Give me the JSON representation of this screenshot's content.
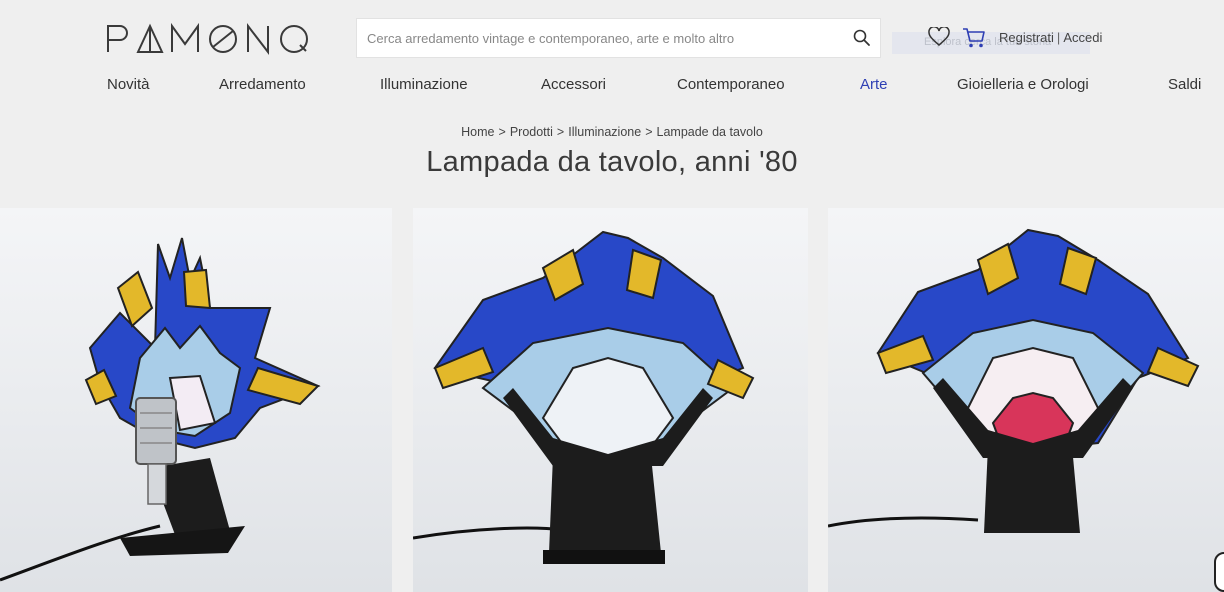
{
  "brand": {
    "logo_text": "PAMONO"
  },
  "search": {
    "placeholder": "Cerca arredamento vintage e contemporaneo, arte e molto altro",
    "overlay_text": "Esplora cerca la tua storia"
  },
  "account": {
    "register": "Registrati",
    "separator": "|",
    "login": "Accedi"
  },
  "nav": {
    "items": [
      {
        "label": "Novità"
      },
      {
        "label": "Arredamento"
      },
      {
        "label": "Illuminazione"
      },
      {
        "label": "Accessori"
      },
      {
        "label": "Contemporaneo"
      },
      {
        "label": "Arte"
      },
      {
        "label": "Gioielleria e Orologi"
      },
      {
        "label": "Saldi"
      }
    ],
    "active": "Arte"
  },
  "breadcrumb": {
    "items": [
      {
        "label": "Home"
      },
      {
        "label": "Prodotti"
      },
      {
        "label": "Illuminazione"
      },
      {
        "label": "Lampade da tavolo"
      }
    ],
    "separator": ">"
  },
  "product": {
    "title": "Lampada da tavolo, anni '80"
  },
  "icons": {
    "search": "search-icon",
    "heart": "heart-icon",
    "cart": "cart-icon"
  },
  "colors": {
    "accent": "#2e3fb4",
    "glass_blue": "#2848c8",
    "glass_light": "#a9cde8",
    "glass_yellow": "#e3b82a",
    "base": "#1c1c1c"
  }
}
